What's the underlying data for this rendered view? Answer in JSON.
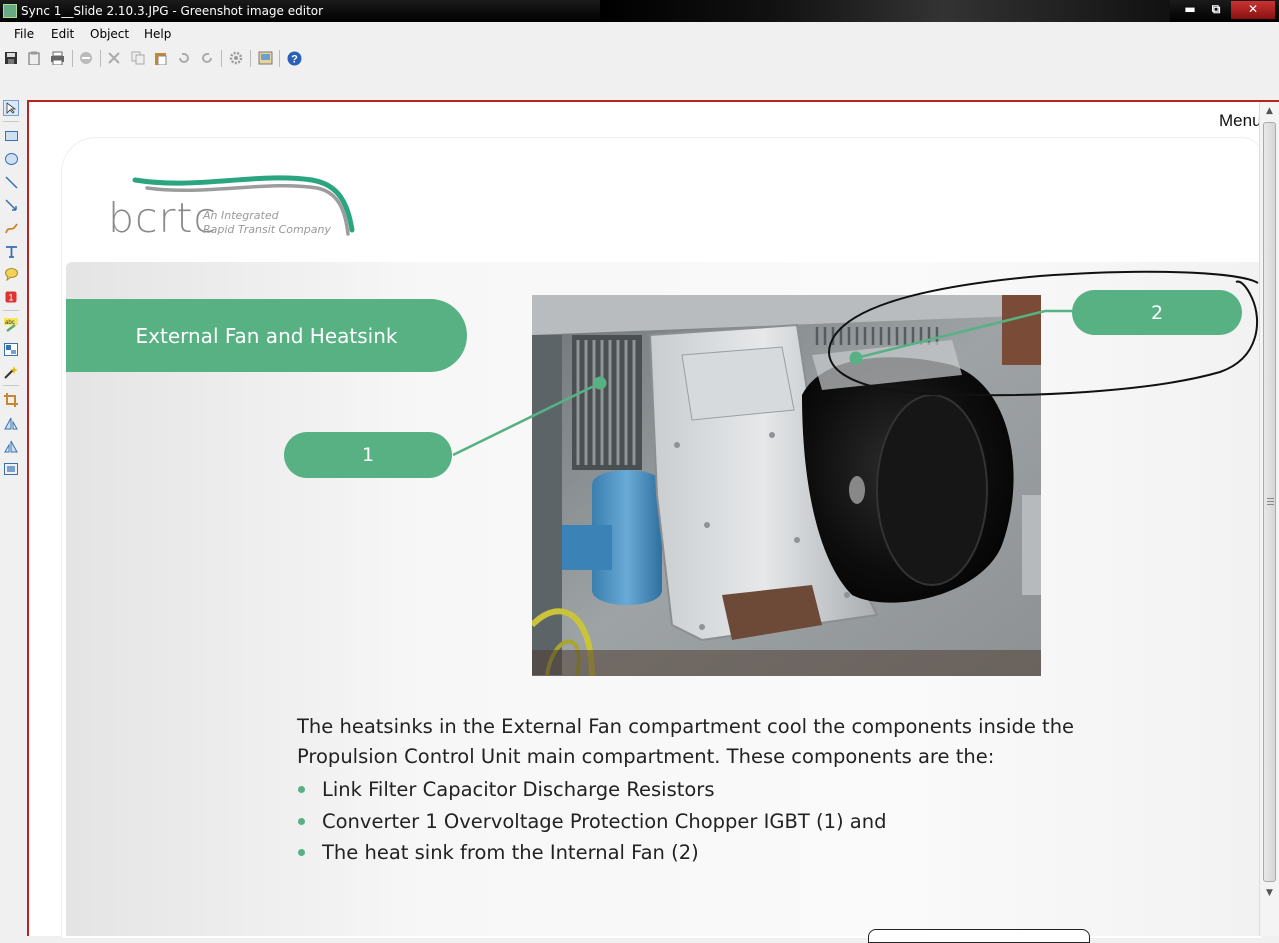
{
  "window": {
    "title": "Sync 1__Slide 2.10.3.JPG - Greenshot image editor",
    "minimize_glyph": "▬",
    "maximize_glyph": "⧉",
    "close_glyph": "✕"
  },
  "menubar": {
    "items": [
      "File",
      "Edit",
      "Object",
      "Help"
    ]
  },
  "toolbar": {
    "buttons": [
      "save-icon",
      "clipboard-icon",
      "print-icon",
      "delete-icon",
      "cut-icon",
      "copy-icon",
      "paste-icon",
      "undo-icon",
      "redo-icon",
      "settings-icon",
      "export-icon",
      "help-icon"
    ]
  },
  "toolstrip": {
    "tools": [
      "select-icon",
      "rectangle-icon",
      "ellipse-icon",
      "line-icon",
      "arrow-icon",
      "freehand-icon",
      "text-icon",
      "speechbubble-icon",
      "counter-icon",
      "highlight-icon",
      "obfuscate-icon",
      "effects-icon",
      "crop-icon",
      "rotate-cw-icon",
      "rotate-ccw-icon",
      "resize-icon"
    ]
  },
  "slide": {
    "menu_label": "Menu",
    "logo": {
      "wordmark": "bcrtc",
      "tagline_line1": "An Integrated",
      "tagline_line2": "Rapid Transit Company"
    },
    "header": "External Fan and Heatsink",
    "callout_1": "1",
    "callout_2": "2",
    "paragraph_line1": "The heatsinks in the External Fan compartment cool the components inside the",
    "paragraph_line2": "Propulsion Control Unit main compartment. These components are the:",
    "bullets": [
      "Link Filter Capacitor Discharge Resistors",
      "Converter 1 Overvoltage Protection Chopper IGBT (1) and",
      "The heat sink  from the Internal Fan (2)"
    ]
  },
  "colors": {
    "accent": "#57b183",
    "annotation_stroke": "#111111",
    "frame_border": "#bb2222"
  }
}
